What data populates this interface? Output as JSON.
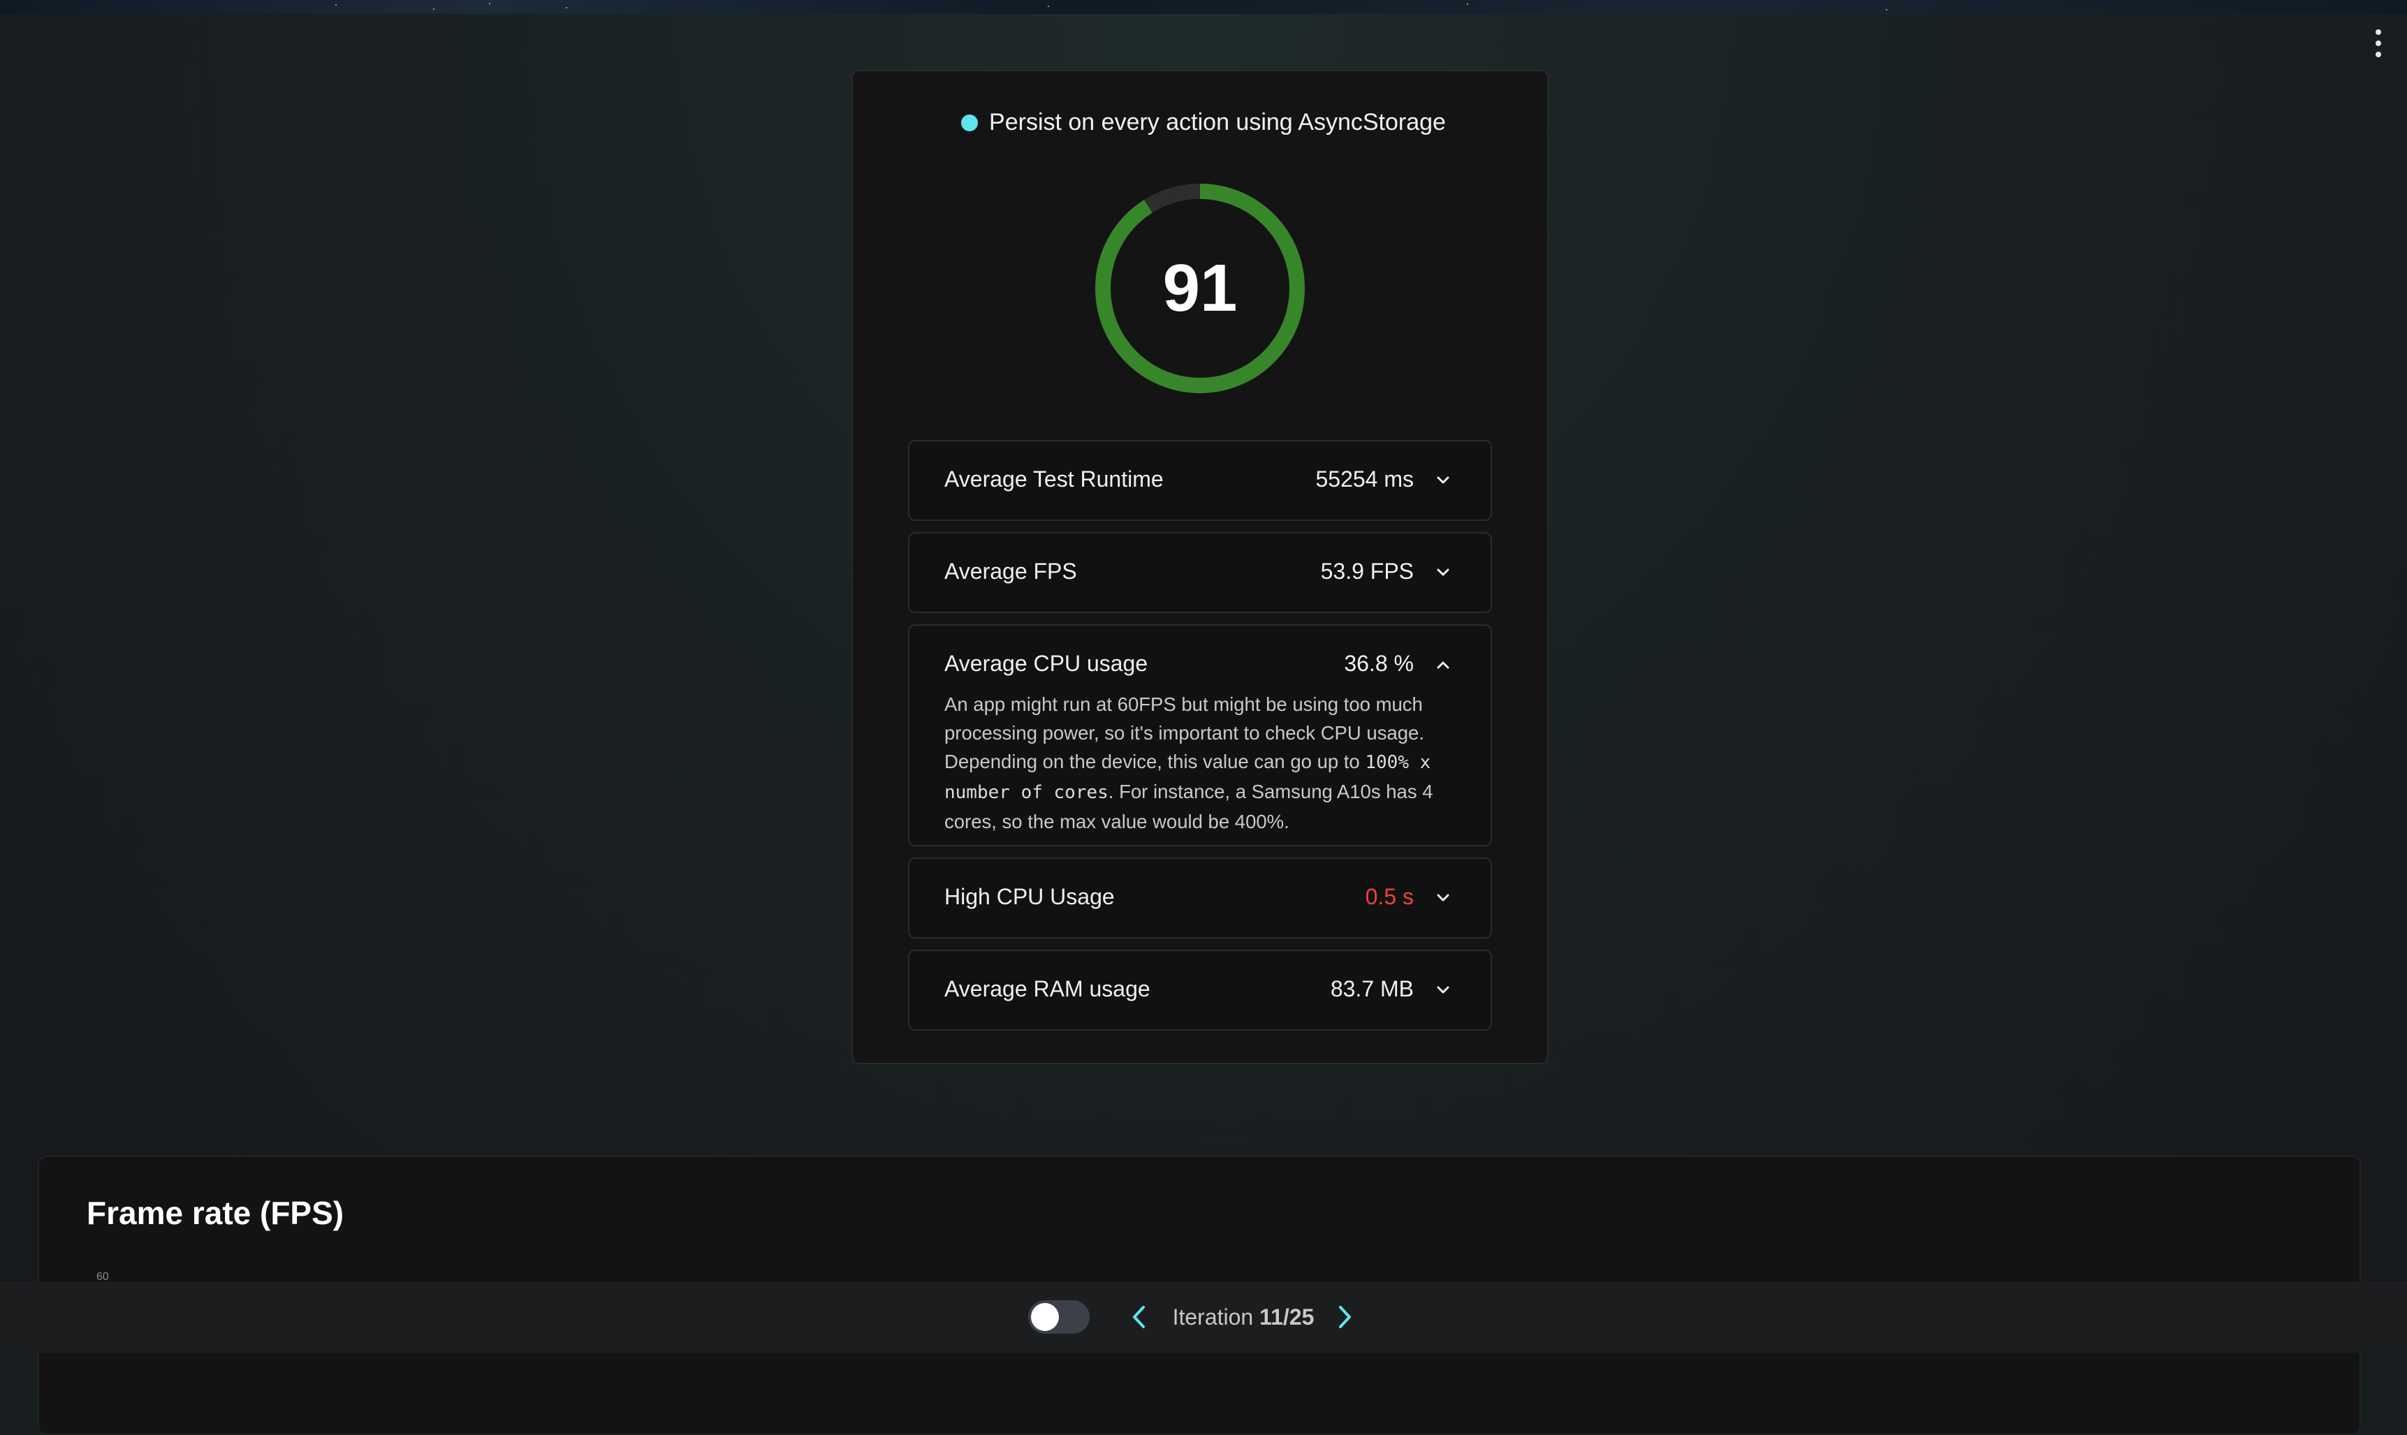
{
  "header": {
    "title": "Persist on every action using AsyncStorage",
    "status_dot_color": "#5ee4ee",
    "menu_icon": "more-vertical-icon"
  },
  "score": {
    "value": "91",
    "fraction": 0.91,
    "color": "#37862a",
    "track_color": "#2d2d2d"
  },
  "metrics": [
    {
      "label": "Average Test Runtime",
      "value": "55254 ms",
      "expanded": false
    },
    {
      "label": "Average FPS",
      "value": "53.9 FPS",
      "expanded": false
    },
    {
      "label": "Average CPU usage",
      "value": "36.8 %",
      "expanded": true,
      "description_before": "An app might run at 60FPS but might be using too much processing power, so it's important to check CPU usage. Depending on the device, this value can go up to ",
      "description_code": "100% x number of cores",
      "description_after": ". For instance, a Samsung A10s has 4 cores, so the max value would be 400%."
    },
    {
      "label": "High CPU Usage",
      "value": "0.5 s",
      "expanded": false,
      "value_color": "#f0423a"
    },
    {
      "label": "Average RAM usage",
      "value": "83.7 MB",
      "expanded": false
    }
  ],
  "fps_section": {
    "title": "Frame rate (FPS)",
    "tick_top": "60"
  },
  "footer": {
    "iteration_label": "Iteration",
    "iteration_value": "11/25",
    "accent": "#5ee4ee"
  }
}
